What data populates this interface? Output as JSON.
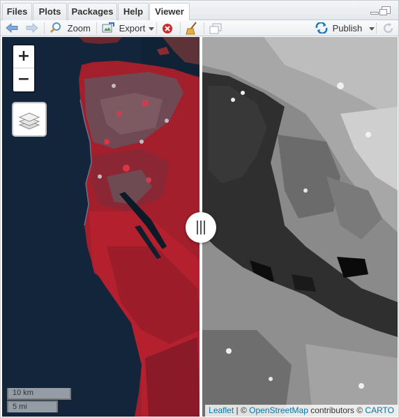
{
  "tabs": [
    {
      "label": "Files",
      "active": false
    },
    {
      "label": "Plots",
      "active": false
    },
    {
      "label": "Packages",
      "active": false
    },
    {
      "label": "Help",
      "active": false
    },
    {
      "label": "Viewer",
      "active": true
    }
  ],
  "toolbar": {
    "zoom_label": "Zoom",
    "export_label": "Export",
    "publish_label": "Publish"
  },
  "map": {
    "zoom_in": "+",
    "zoom_out": "−",
    "scale_km": "10 km",
    "scale_mi": "5 mi",
    "attribution": {
      "leaflet": "Leaflet",
      "sep1": " | © ",
      "osm": "OpenStreetMap",
      "contrib": " contributors © ",
      "carto": "CARTO"
    }
  },
  "colors": {
    "accent_link": "#0078a8",
    "publish_blue": "#1c77c3",
    "remove_red": "#cc2b2b"
  }
}
